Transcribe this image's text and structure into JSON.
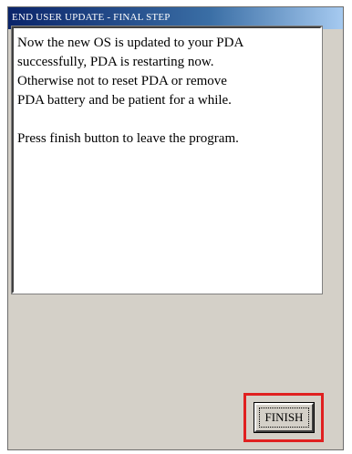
{
  "window": {
    "title": "END USER UPDATE - FINAL STEP"
  },
  "message": {
    "lines": [
      "Now the new OS is updated to your PDA",
      "successfully, PDA is restarting now.",
      "Otherwise not to reset PDA or remove",
      "PDA battery and be patient for a while.",
      "",
      "Press finish button to leave the program."
    ]
  },
  "buttons": {
    "finish_label": "FINISH"
  },
  "colors": {
    "titlebar_start": "#0a246a",
    "titlebar_end": "#a6caf0",
    "dialog_face": "#d4d0c8",
    "highlight_border": "#e02020"
  }
}
